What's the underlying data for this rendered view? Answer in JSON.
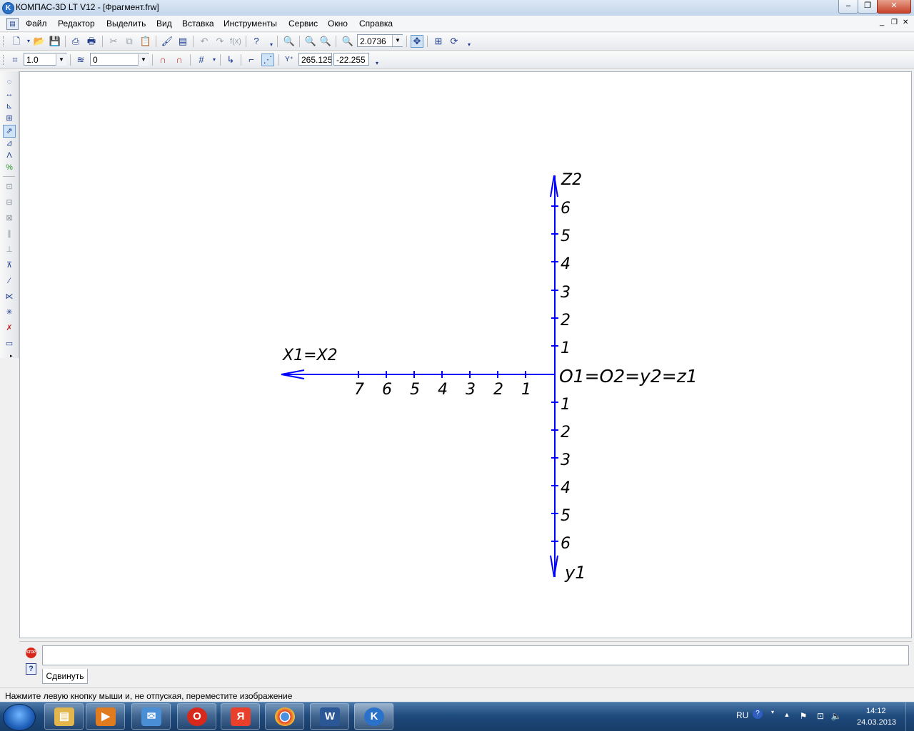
{
  "window": {
    "title": "КОМПАС-3D LT V12 - [Фрагмент.frw]",
    "app_icon": "K",
    "minimize": "–",
    "maximize": "❐",
    "close": "✕",
    "doc_minimize": "_",
    "doc_restore": "❐",
    "doc_close": "✕"
  },
  "menu": {
    "items": [
      "Файл",
      "Редактор",
      "Выделить",
      "Вид",
      "Вставка",
      "Инструменты",
      "Сервис",
      "Окно",
      "Справка"
    ]
  },
  "toolbar_standard": {
    "zoom_value": "2.0736"
  },
  "toolbar_current_state": {
    "step_value": "1.0",
    "layer_value": "0",
    "coord_x": "265.125",
    "coord_y": "-22.255"
  },
  "drawing": {
    "color": "#0000ff",
    "axis_x_label": "X1=X2",
    "axis_z_label": "Z2",
    "axis_y_label": "y1",
    "origin_label": "O1=O2=y2=z1",
    "x_ticks": [
      "7",
      "6",
      "5",
      "4",
      "3",
      "2",
      "1"
    ],
    "z_ticks": [
      "6",
      "5",
      "4",
      "3",
      "2",
      "1"
    ],
    "y_ticks": [
      "1",
      "2",
      "3",
      "4",
      "5",
      "6"
    ]
  },
  "command_panel": {
    "tab_label": "Сдвинуть",
    "stop_icon": "STOP",
    "help_icon": "?"
  },
  "status": {
    "text": "Нажмите левую кнопку мыши и, не отпуская, переместите изображение"
  },
  "taskbar": {
    "language": "RU",
    "time": "14:12",
    "date": "24.03.2013",
    "apps": [
      "explorer-icon",
      "media-player-icon",
      "mail-icon",
      "opera-icon",
      "yandex-icon",
      "chrome-icon",
      "word-icon",
      "kompas-icon"
    ]
  }
}
